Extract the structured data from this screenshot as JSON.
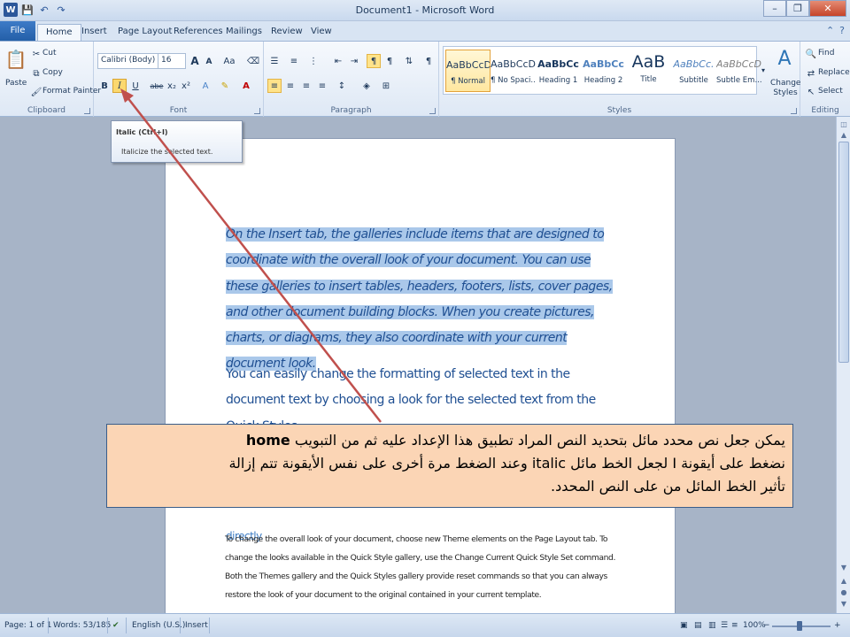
{
  "window": {
    "title": "Document1  -  Microsoft Word"
  },
  "quick_access": {
    "logo": "W",
    "save": "💾",
    "undo": "↶",
    "redo": "↷"
  },
  "tabs": [
    "File",
    "Home",
    "Insert",
    "Page Layout",
    "References",
    "Mailings",
    "Review",
    "View"
  ],
  "ribbon": {
    "clipboard": {
      "paste": "Paste",
      "cut": "Cut",
      "copy": "Copy",
      "format_painter": "Format Painter",
      "label": "Clipboard"
    },
    "font": {
      "font_name": "Calibri (Body)",
      "font_size": "16",
      "grow": "A",
      "shrink": "A",
      "change_case": "Aa",
      "bold": "B",
      "italic": "I",
      "underline": "U",
      "strike": "abe",
      "subscript": "x₂",
      "superscript": "x²",
      "label": "Font"
    },
    "paragraph": {
      "label": "Paragraph",
      "show_hide": "¶"
    },
    "styles": {
      "label": "Styles",
      "items": [
        {
          "preview": "AaBbCcDc",
          "name": "¶ Normal"
        },
        {
          "preview": "AaBbCcDc",
          "name": "¶ No Spaci..."
        },
        {
          "preview": "AaBbCc",
          "name": "Heading 1"
        },
        {
          "preview": "AaBbCc",
          "name": "Heading 2"
        },
        {
          "preview": "AaB",
          "name": "Title"
        },
        {
          "preview": "AaBbCc.",
          "name": "Subtitle"
        },
        {
          "preview": "AaBbCcDc",
          "name": "Subtle Em..."
        }
      ],
      "change_styles": "Change Styles"
    },
    "editing": {
      "find": "Find",
      "replace": "Replace",
      "select": "Select",
      "label": "Editing"
    }
  },
  "tooltip": {
    "title": "Italic (Ctrl+I)",
    "description": "Italicize the selected text."
  },
  "document": {
    "para1": "On the Insert tab, the galleries include items that are designed to coordinate with the overall look of your document. You can use these galleries to insert tables, headers, footers, lists, cover pages, and other document building blocks. When you create pictures, charts, or diagrams, they also coordinate with your current document look.",
    "para2": "You can easily change the formatting of selected text in the document text by choosing a look for the selected text from the Quick Styles",
    "para3": "directly.",
    "para4": "To change the overall look of your document, choose new Theme elements on the Page Layout tab. To change the looks available in the Quick Style gallery, use the Change Current Quick Style Set command. Both the Themes gallery and the Quick Styles gallery provide reset commands so that you can always restore the look of your document to the original contained in your current template."
  },
  "callout": {
    "line1_pre": "يمكن جعل نص محدد مائل بتحديد النص المراد تطبيق هذا الإعداد عليه ثم من التبويب ",
    "line1_bold": "home",
    "line2": "نضغط على أيقونة I لجعل الخط مائل italic وعند الضغط مرة أخرى على نفس الأيقونة تتم إزالة",
    "line3": "تأثير الخط المائل من على النص المحدد."
  },
  "status": {
    "page": "Page: 1 of 1",
    "words": "Words: 53/185",
    "language": "English (U.S.)",
    "mode": "Insert",
    "zoom": "100%"
  },
  "colors": {
    "selection": "#aac8ea",
    "doc_text": "#1f4f92",
    "arrow": "#c0504d",
    "callout_bg": "#fbd5b5"
  }
}
